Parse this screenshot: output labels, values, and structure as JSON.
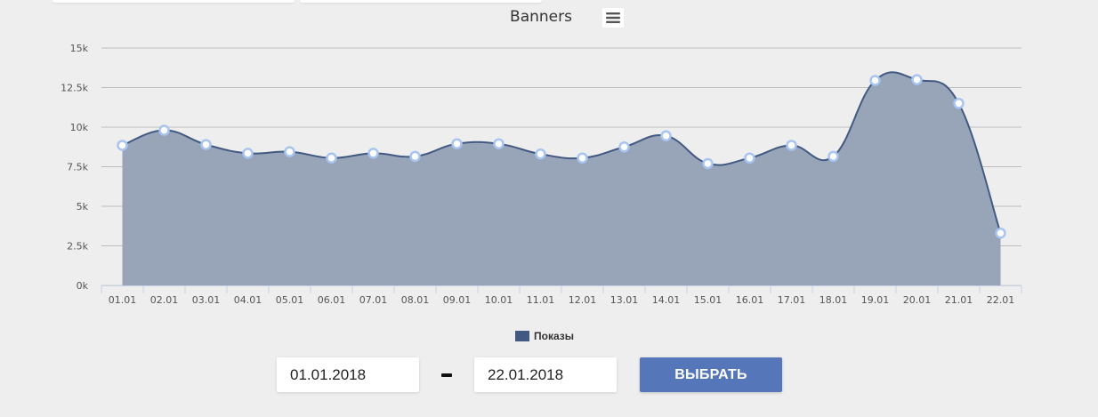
{
  "chart_data": {
    "type": "area",
    "title": "Banners",
    "categories": [
      "01.01",
      "02.01",
      "03.01",
      "04.01",
      "05.01",
      "06.01",
      "07.01",
      "08.01",
      "09.01",
      "10.01",
      "11.01",
      "12.01",
      "13.01",
      "14.01",
      "15.01",
      "16.01",
      "17.01",
      "18.01",
      "19.01",
      "20.01",
      "21.01",
      "22.01"
    ],
    "series": [
      {
        "name": "Показы",
        "color": "#425a82",
        "values": [
          8850,
          9800,
          8900,
          8350,
          8450,
          8050,
          8350,
          8150,
          8950,
          8950,
          8300,
          8050,
          8750,
          9450,
          7700,
          8050,
          8850,
          8150,
          12950,
          13000,
          11500,
          3300
        ]
      }
    ],
    "ylim": [
      0,
      15000
    ],
    "yticks": [
      0,
      2500,
      5000,
      7500,
      10000,
      12500,
      15000
    ],
    "ytick_labels": [
      "0k",
      "2.5k",
      "5k",
      "7.5k",
      "10k",
      "12.5k",
      "15k"
    ],
    "grid": true,
    "legend_position": "bottom-center",
    "fill_color": "#98a4b8",
    "marker_color": "#a8c4f0"
  },
  "filters": {
    "date_from": "01.01.2018",
    "date_to": "22.01.2018",
    "submit_label": "ВЫБРАТЬ",
    "submit_color": "#5577b9"
  },
  "menu_icon": "hamburger-menu-icon"
}
